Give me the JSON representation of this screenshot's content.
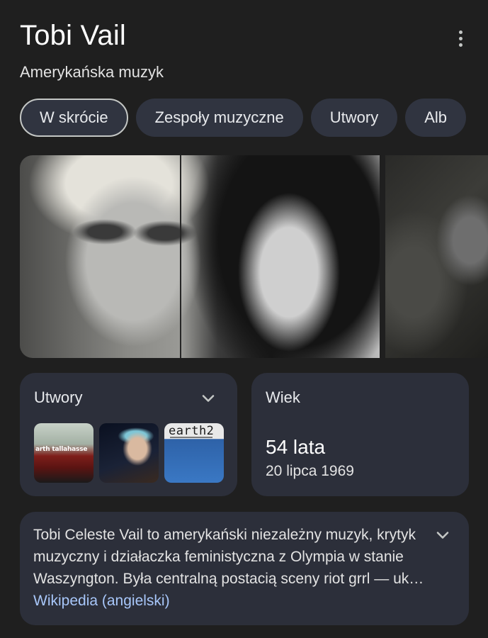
{
  "header": {
    "title": "Tobi Vail",
    "subtitle": "Amerykańska muzyk"
  },
  "tabs": [
    {
      "label": "W skrócie",
      "active": true
    },
    {
      "label": "Zespoły muzyczne",
      "active": false
    },
    {
      "label": "Utwory",
      "active": false
    },
    {
      "label": "Alb",
      "active": false
    }
  ],
  "songs_card": {
    "label": "Utwory",
    "thumb1_text": "arth tallahasse",
    "thumb3_text": "earth2"
  },
  "age_card": {
    "label": "Wiek",
    "value": "54 lata",
    "birth_date": "20 lipca 1969"
  },
  "description": {
    "text": "Tobi Celeste Vail to amerykański niezależny muzyk, krytyk muzyczny i działaczka feministyczna z Olympia w stanie Waszyngton. Była centralną postacią sceny riot grrl — uk…",
    "source_link": "Wikipedia (angielski)"
  },
  "colors": {
    "background": "#1f1f1f",
    "card": "#2c2f3a",
    "chip": "#303440",
    "link": "#a8c7fa"
  },
  "icons": {
    "more": "more-vert-icon",
    "expand": "chevron-down-icon"
  }
}
